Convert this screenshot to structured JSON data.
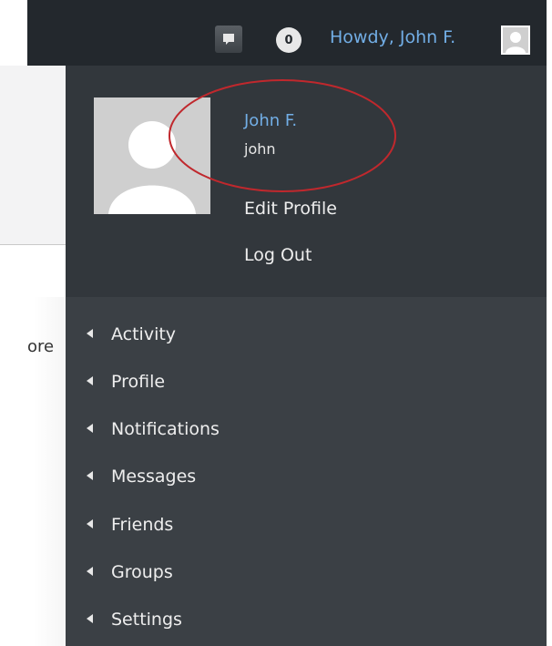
{
  "adminbar": {
    "comments_icon": "speech-bubble-icon",
    "comment_count": "0",
    "howdy_text": "Howdy, John F.",
    "avatar_icon": "avatar-icon"
  },
  "page": {
    "partial_text": "ore"
  },
  "profile": {
    "avatar_icon": "default-avatar-icon",
    "display_name": "John F.",
    "username": "john",
    "edit_profile": "Edit Profile",
    "log_out": "Log Out"
  },
  "menu": {
    "items": [
      {
        "label": "Activity"
      },
      {
        "label": "Profile"
      },
      {
        "label": "Notifications"
      },
      {
        "label": "Messages"
      },
      {
        "label": "Friends"
      },
      {
        "label": "Groups"
      },
      {
        "label": "Settings"
      }
    ]
  },
  "colors": {
    "adminbar_bg": "#23282d",
    "profile_bg": "#32373c",
    "menu_bg": "#3b4045",
    "link_blue": "#72aee6",
    "annotation_red": "#c0282d"
  }
}
